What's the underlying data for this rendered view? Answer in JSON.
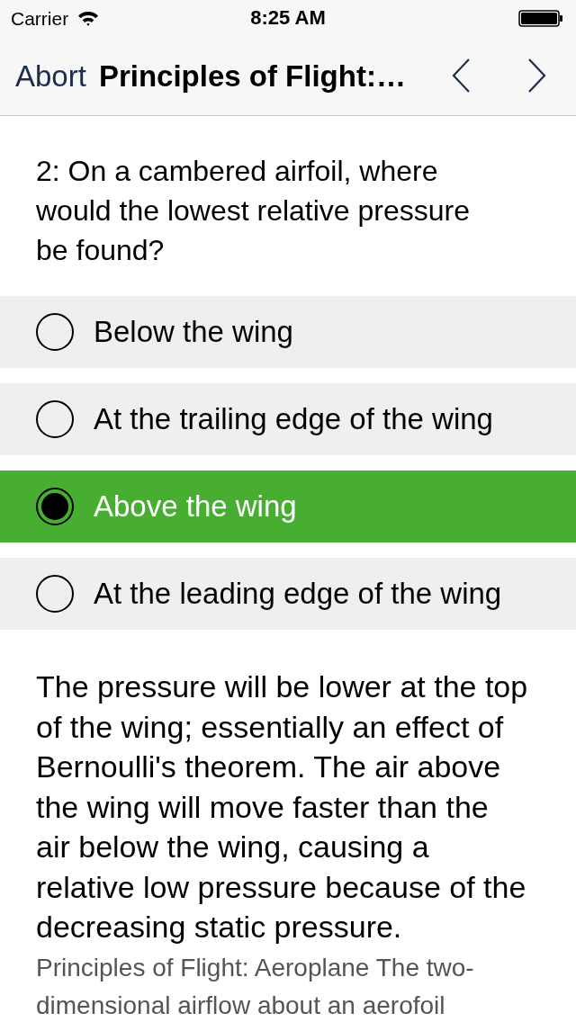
{
  "status_bar": {
    "carrier": "Carrier",
    "time": "8:25 AM"
  },
  "nav_bar": {
    "back": "Abort",
    "title": "Principles of Flight:…"
  },
  "question": "2: On a cambered airfoil, where would the lowest relative pressure be found?",
  "options": [
    {
      "label": "Below the wing",
      "selected": false
    },
    {
      "label": "At the trailing edge of the wing",
      "selected": false
    },
    {
      "label": "Above the wing",
      "selected": true
    },
    {
      "label": "At the leading edge of the wing",
      "selected": false
    }
  ],
  "explanation": "The pressure will be lower at the top of the wing; essentially an effect of Bernoulli's theorem. The air above the wing will move faster than the air below the wing, causing a relative low pressure because of the decreasing static pressure.",
  "source": "Principles of Flight: Aeroplane The two-dimensional airflow about an aerofoil"
}
